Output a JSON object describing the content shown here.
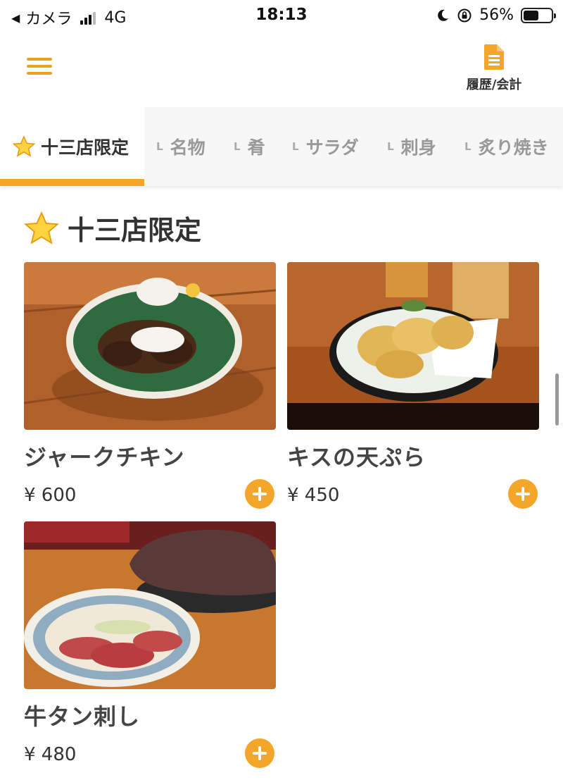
{
  "status_bar": {
    "back_app": "カメラ",
    "network": "4G",
    "time": "18:13",
    "battery": "56%",
    "battery_level": 0.56
  },
  "header": {
    "menu_icon": "hamburger-icon",
    "history_label": "履歴/会計",
    "history_icon": "document-icon"
  },
  "tabs": [
    {
      "label": "十三店限定",
      "prefix": "",
      "active": true
    },
    {
      "label": "名物",
      "prefix": "L"
    },
    {
      "label": "肴",
      "prefix": "L"
    },
    {
      "label": "サラダ",
      "prefix": "L"
    },
    {
      "label": "刺身",
      "prefix": "L"
    },
    {
      "label": "炙り焼き",
      "prefix": "L"
    }
  ],
  "section": {
    "title": "十三店限定",
    "icon": "star-icon"
  },
  "items": [
    {
      "name": "ジャークチキン",
      "price": "¥ 600"
    },
    {
      "name": "キスの天ぷら",
      "price": "¥ 450"
    },
    {
      "name": "牛タン刺し",
      "price": "¥ 480"
    }
  ],
  "colors": {
    "accent": "#f4a62a",
    "text": "#333333",
    "tab_inactive": "#999999"
  }
}
